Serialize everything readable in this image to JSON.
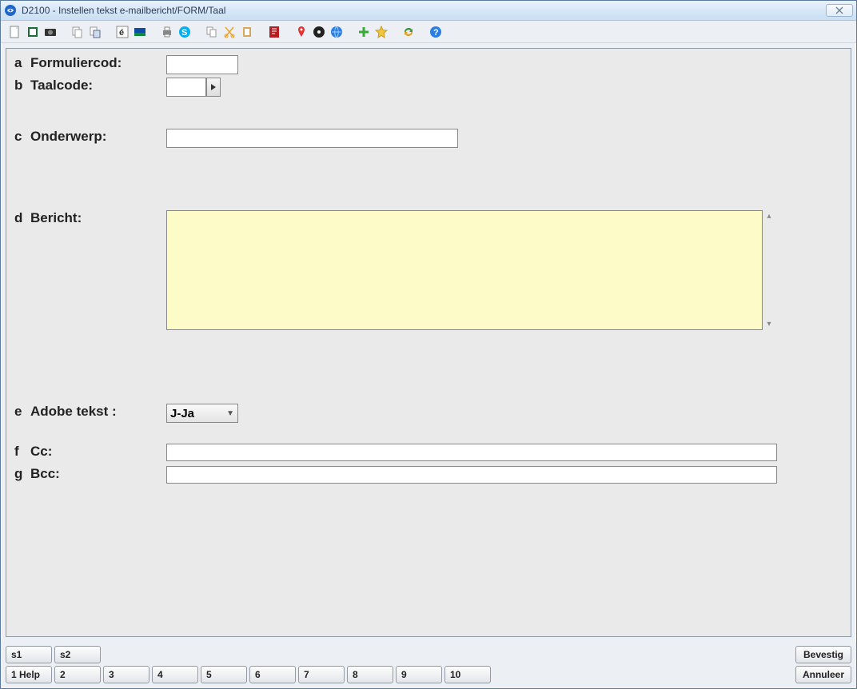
{
  "window": {
    "title": "D2100 - Instellen tekst e-mailbericht/FORM/Taal",
    "close_glyph": "✕"
  },
  "toolbar_icons": [
    "new-icon",
    "book-icon",
    "camera-icon",
    "copy-icon",
    "paste-special-icon",
    "accent-icon",
    "card-icon",
    "print-icon",
    "skype-icon",
    "copy2-icon",
    "cut-icon",
    "clipboard-icon",
    "pdf-icon",
    "pin-icon",
    "disc-icon",
    "globe-icon",
    "plus-icon",
    "star-icon",
    "refresh-icon",
    "help-icon"
  ],
  "form": {
    "a": {
      "letter": "a",
      "label": "Formuliercod:",
      "value": ""
    },
    "b": {
      "letter": "b",
      "label": "Taalcode:",
      "value": "",
      "lookup_glyph": "▶"
    },
    "c": {
      "letter": "c",
      "label": "Onderwerp:",
      "value": ""
    },
    "d": {
      "letter": "d",
      "label": "Bericht:",
      "value": ""
    },
    "e": {
      "letter": "e",
      "label": "Adobe tekst :",
      "selected": "J-Ja"
    },
    "f": {
      "letter": "f",
      "label": "Cc:",
      "value": ""
    },
    "g": {
      "letter": "g",
      "label": "Bcc:",
      "value": ""
    }
  },
  "buttons": {
    "s1": "s1",
    "s2": "s2",
    "confirm": "Bevestig",
    "cancel": "Annuleer",
    "fkeys": [
      "1 Help",
      "2",
      "3",
      "4",
      "5",
      "6",
      "7",
      "8",
      "9",
      "10"
    ]
  }
}
